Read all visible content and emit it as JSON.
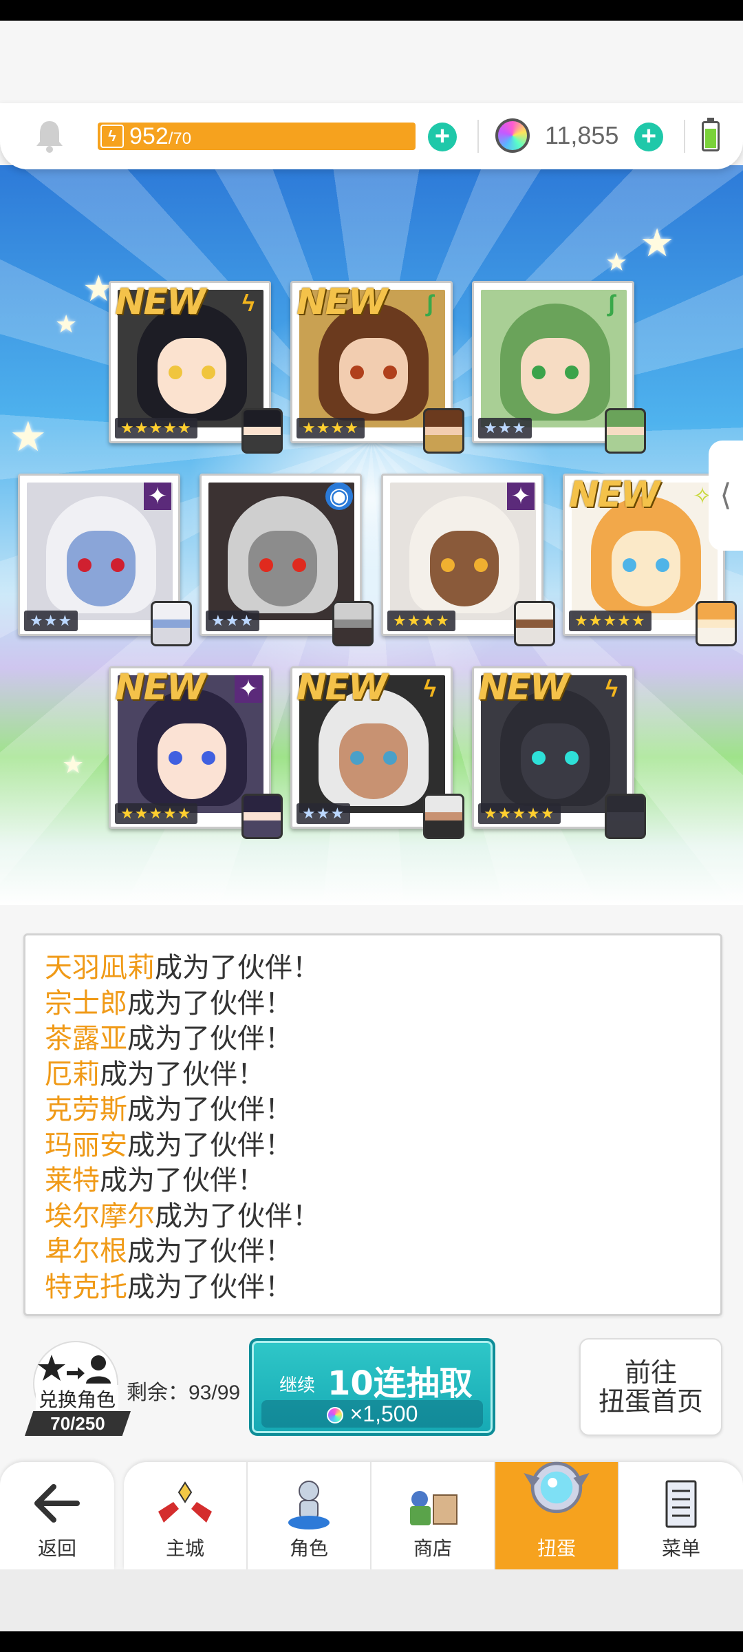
{
  "topbar": {
    "energy_current": "952",
    "energy_max": "/70",
    "gems": "11,855"
  },
  "cards": [
    {
      "new": true,
      "element": "thunder",
      "element_glyph": "ϟ",
      "stars": "★★★★★",
      "rarity": 5,
      "hair": "#1d1d25",
      "skin": "#fbe2cf",
      "eye": "#f0c53e",
      "bg": "#3a3a3a"
    },
    {
      "new": true,
      "element": "nature",
      "element_glyph": "∫",
      "stars": "★★★★",
      "rarity": 4,
      "hair": "#6b3a1e",
      "skin": "#f2cdb0",
      "eye": "#b0401c",
      "bg": "#c9a152"
    },
    {
      "new": false,
      "element": "nature",
      "element_glyph": "∫",
      "stars": "★★★",
      "rarity": 3,
      "hair": "#6aa35a",
      "skin": "#f6dcc3",
      "eye": "#3ba34a",
      "bg": "#a9cf95"
    },
    {
      "new": false,
      "element": "dark",
      "element_glyph": "✦",
      "stars": "★★★",
      "rarity": 3,
      "hair": "#f0f0f4",
      "skin": "#8aa5d8",
      "eye": "#d02030",
      "bg": "#d8d8e0"
    },
    {
      "new": false,
      "element": "water",
      "element_glyph": "◉",
      "stars": "★★★",
      "rarity": 3,
      "hair": "#cfcfcf",
      "skin": "#8c8c8c",
      "eye": "#e02a1e",
      "bg": "#3b3232"
    },
    {
      "new": false,
      "element": "dark",
      "element_glyph": "✦",
      "stars": "★★★★",
      "rarity": 4,
      "hair": "#f4f0ea",
      "skin": "#8a5a3a",
      "eye": "#f0b030",
      "bg": "#e6e2de"
    },
    {
      "new": true,
      "element": "light",
      "element_glyph": "✧",
      "stars": "★★★★★",
      "rarity": 5,
      "hair": "#f2a84a",
      "skin": "#fbe9c8",
      "eye": "#4fb4e8",
      "bg": "#f7f2e8"
    },
    {
      "new": true,
      "element": "dark",
      "element_glyph": "✦",
      "stars": "★★★★★",
      "rarity": 5,
      "hair": "#2a2440",
      "skin": "#fbe2d4",
      "eye": "#4060e0",
      "bg": "#4b4462"
    },
    {
      "new": true,
      "element": "thunder",
      "element_glyph": "ϟ",
      "stars": "★★★",
      "rarity": 3,
      "hair": "#e8e8e8",
      "skin": "#c89272",
      "eye": "#4aa0c8",
      "bg": "#2e2e2e"
    },
    {
      "new": true,
      "element": "thunder",
      "element_glyph": "ϟ",
      "stars": "★★★★★",
      "rarity": 5,
      "hair": "#2c2c34",
      "skin": "#3a3a44",
      "eye": "#2ee0d8",
      "bg": "#3a3a42"
    }
  ],
  "new_label": "NEW",
  "log": [
    {
      "name": "天羽凪莉",
      "text": "成为了伙伴！"
    },
    {
      "name": "宗士郎",
      "text": "成为了伙伴！"
    },
    {
      "name": "茶露亚",
      "text": "成为了伙伴！"
    },
    {
      "name": "厄莉",
      "text": "成为了伙伴！"
    },
    {
      "name": "克劳斯",
      "text": "成为了伙伴！"
    },
    {
      "name": "玛丽安",
      "text": "成为了伙伴！"
    },
    {
      "name": "莱特",
      "text": "成为了伙伴！"
    },
    {
      "name": "埃尔摩尔",
      "text": "成为了伙伴！"
    },
    {
      "name": "卑尔根",
      "text": "成为了伙伴！"
    },
    {
      "name": "特克托",
      "text": "成为了伙伴！"
    }
  ],
  "exchange": {
    "label": "兑换角色",
    "count": "70/250"
  },
  "remain": "剩余：93/99",
  "gacha_button": {
    "prefix": "继续",
    "label": "10连抽取",
    "cost": "×1,500"
  },
  "goto_button": {
    "line1": "前往",
    "line2": "扭蛋首页"
  },
  "nav": {
    "back": "返回",
    "tabs": [
      {
        "label": "主城",
        "icon": "castle-icon",
        "active": false
      },
      {
        "label": "角色",
        "icon": "character-icon",
        "active": false
      },
      {
        "label": "商店",
        "icon": "shop-icon",
        "active": false
      },
      {
        "label": "扭蛋",
        "icon": "gacha-icon",
        "active": true
      },
      {
        "label": "菜单",
        "icon": "menu-icon",
        "active": false
      }
    ]
  },
  "colors": {
    "accent_orange": "#f6a21e",
    "teal": "#1fc8a9",
    "name_orange": "#f09a17"
  }
}
